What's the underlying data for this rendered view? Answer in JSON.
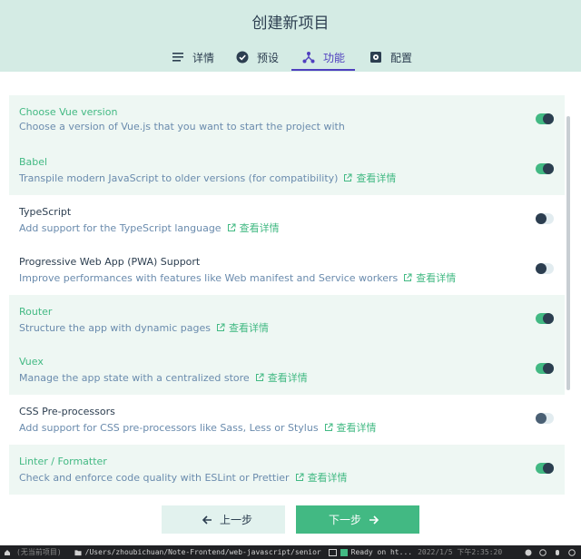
{
  "header": {
    "title": "创建新项目",
    "tabs": [
      {
        "label": "详情",
        "icon": "list-icon"
      },
      {
        "label": "预设",
        "icon": "check-circle-icon"
      },
      {
        "label": "功能",
        "icon": "fork-icon",
        "active": true
      },
      {
        "label": "配置",
        "icon": "settings-chip-icon"
      }
    ]
  },
  "features": [
    {
      "name": "Choose Vue version",
      "desc": "Choose a version of Vue.js that you want to start the project with",
      "more": "",
      "enabled": true
    },
    {
      "name": "Babel",
      "desc": "Transpile modern JavaScript to older versions (for compatibility)",
      "more": "查看详情",
      "enabled": true
    },
    {
      "name": "TypeScript",
      "desc": "Add support for the TypeScript language",
      "more": "查看详情",
      "enabled": false
    },
    {
      "name": "Progressive Web App (PWA) Support",
      "desc": "Improve performances with features like Web manifest and Service workers",
      "more": "查看详情",
      "enabled": false
    },
    {
      "name": "Router",
      "desc": "Structure the app with dynamic pages",
      "more": "查看详情",
      "enabled": true
    },
    {
      "name": "Vuex",
      "desc": "Manage the app state with a centralized store",
      "more": "查看详情",
      "enabled": true
    },
    {
      "name": "CSS Pre-processors",
      "desc": "Add support for CSS pre-processors like Sass, Less or Stylus",
      "more": "查看详情",
      "enabled": false
    },
    {
      "name": "Linter / Formatter",
      "desc": "Check and enforce code quality with ESLint or Prettier",
      "more": "查看详情",
      "enabled": true
    }
  ],
  "footer": {
    "prev_label": "上一步",
    "next_label": "下一步"
  },
  "taskbar": {
    "project": "(无当前项目)",
    "path": "/Users/zhoubichuan/Note-Frontend/web-javascript/senior/micro",
    "status": "Ready on ht...",
    "datetime": "2022/1/5 下午2:35:20"
  },
  "colors": {
    "accent": "#42b983",
    "tab_active": "#4f3fbf",
    "header_bg": "#d4ebe4"
  }
}
